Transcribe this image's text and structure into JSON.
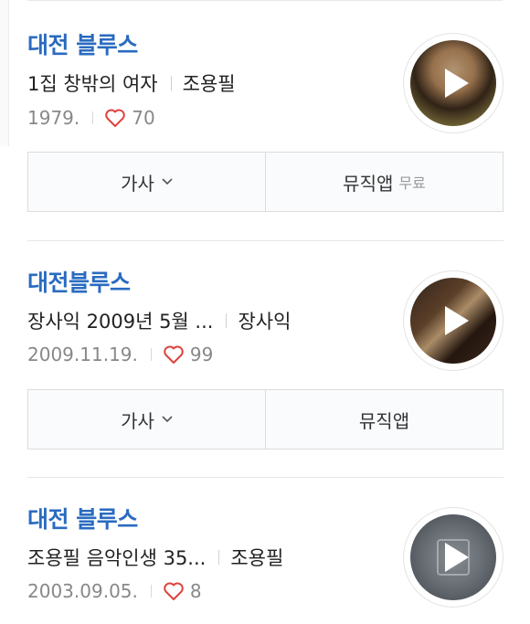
{
  "results": [
    {
      "title": "대전 블루스",
      "album": "1집 창밖의 여자",
      "artist": "조용필",
      "date": "1979.",
      "likes": "70",
      "thumb_icon": "play-icon",
      "lyrics_label": "가사",
      "mv_label": "뮤직앱",
      "mv_badge": "무료"
    },
    {
      "title": "대전블루스",
      "album": "장사익 2009년 5월 ...",
      "artist": "장사익",
      "date": "2009.11.19.",
      "likes": "99",
      "thumb_icon": "play-icon",
      "lyrics_label": "가사",
      "mv_label": "뮤직앱",
      "mv_badge": ""
    },
    {
      "title": "대전 블루스",
      "album": "조용필 음악인생 35...",
      "artist": "조용필",
      "date": "2003.09.05.",
      "likes": "8",
      "thumb_icon": "play-icon"
    }
  ],
  "colors": {
    "title": "#2a6bc0",
    "heart": "#e0413c",
    "meta": "#888888"
  }
}
